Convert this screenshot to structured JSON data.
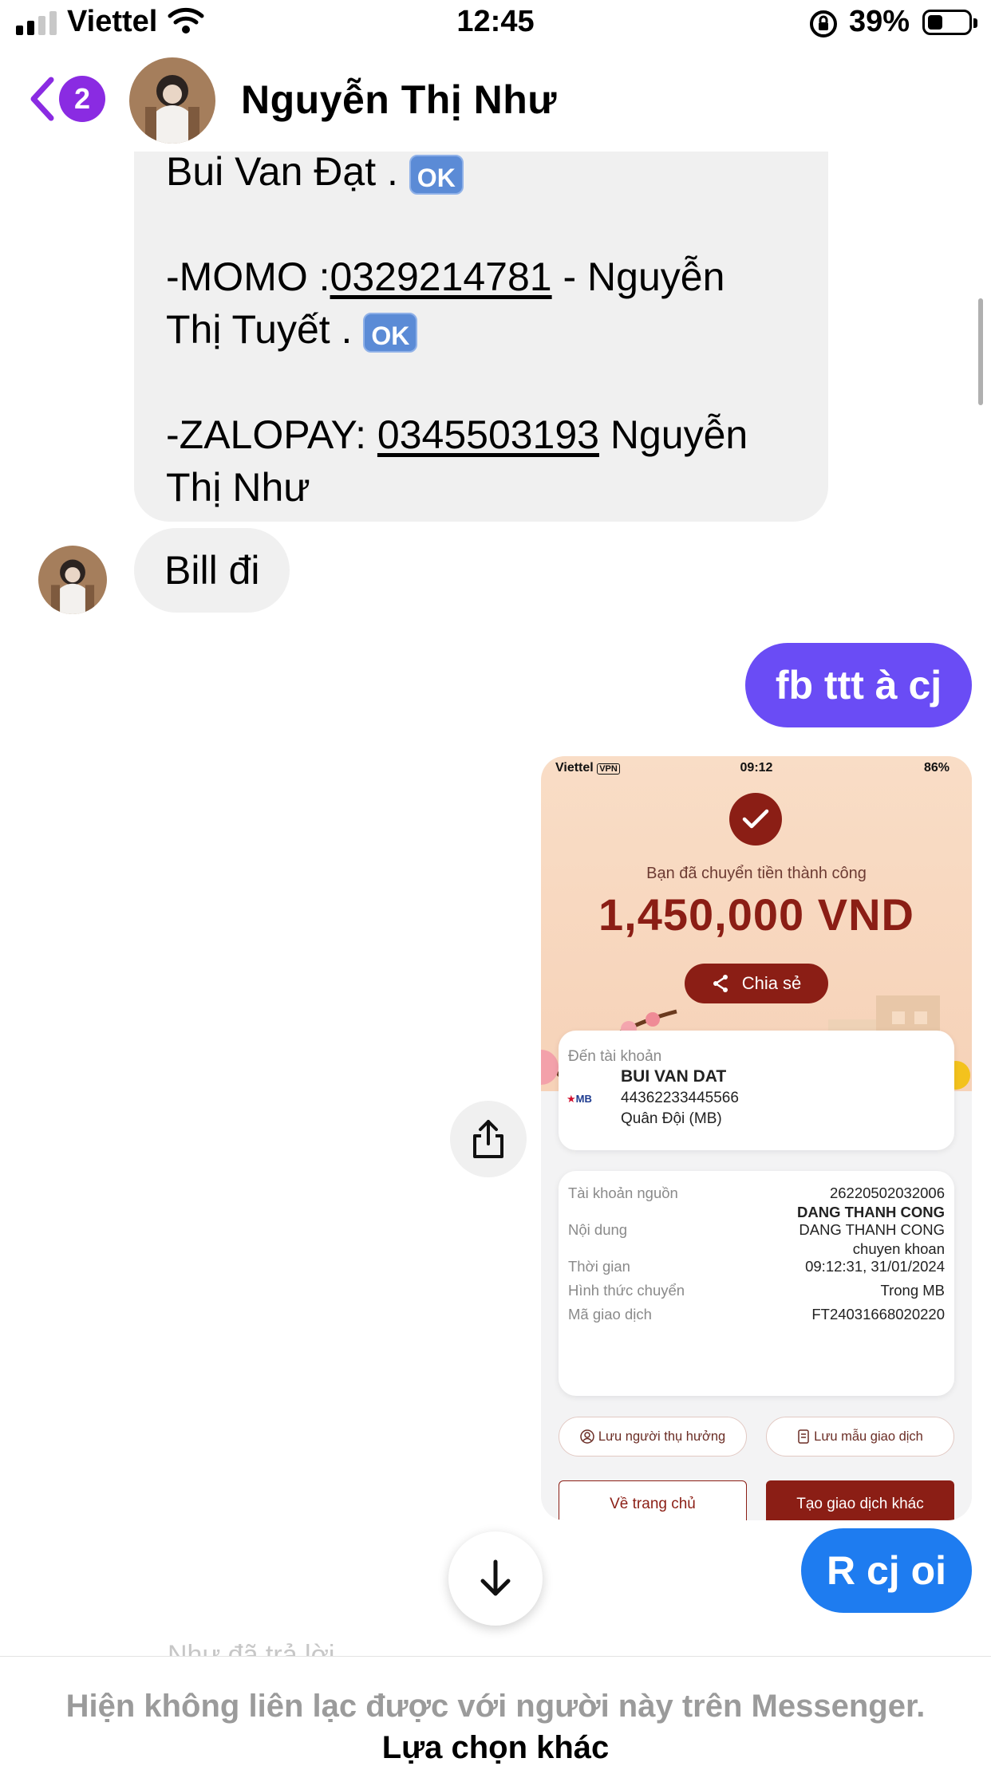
{
  "status_bar": {
    "carrier": "Viettel",
    "time": "12:45",
    "battery_percent": "39%"
  },
  "header": {
    "back_badge_count": "2",
    "contact_name": "Nguyễn Thị Như"
  },
  "messages": {
    "incoming_long": {
      "line1_text": "Bui Van Đạt . ",
      "line1_emoji": "OK",
      "momo_prefix": "-MOMO :",
      "momo_number": "0329214781",
      "momo_suffix": " - Nguyễn",
      "momo_name_line": "Thị Tuyết . ",
      "momo_emoji": "OK",
      "zalopay_prefix": "-ZALOPAY: ",
      "zalopay_number": "0345503193",
      "zalopay_suffix": " Nguyễn",
      "zalopay_name_line": "Thị Như"
    },
    "incoming_bill": "Bill đi",
    "outgoing_fb": "fb ttt à cj",
    "outgoing_rcj": "R cj oi"
  },
  "receipt": {
    "status_carrier": "Viettel",
    "status_vpn": "VPN",
    "status_time": "09:12",
    "status_battery": "86%",
    "success_text": "Bạn đã chuyển tiền thành công",
    "amount": "1,450,000 VND",
    "share_label": "Chia sẻ",
    "to_account_label": "Đến tài khoản",
    "bank_logo_text": "MB",
    "recipient_name": "BUI VAN DAT",
    "recipient_account": "44362233445566",
    "recipient_bank": "Quân Đội (MB)",
    "details": [
      {
        "label": "Tài khoản nguồn",
        "value": "26220502032006",
        "value2": "DANG THANH CONG"
      },
      {
        "label": "Nội dung",
        "value": "DANG THANH CONG",
        "value2": "chuyen khoan"
      },
      {
        "label": "Thời gian",
        "value": "09:12:31, 31/01/2024"
      },
      {
        "label": "Hình thức chuyển",
        "value": "Trong MB"
      },
      {
        "label": "Mã giao dịch",
        "value": "FT24031668020220"
      }
    ],
    "save_recipient": "Lưu người thụ hưởng",
    "save_template": "Lưu mẫu giao dịch",
    "home_button": "Về trang chủ",
    "new_transaction_button": "Tạo giao dịch khác"
  },
  "footer": {
    "faded_seen_text": "Như đã trả lời",
    "unavailable_notice": "Hiện không liên lạc được với người này trên Messenger.",
    "other_options": "Lựa chọn khác"
  },
  "colors": {
    "accent_purple": "#8a2be2",
    "outgoing_purple": "#6a4cf5",
    "outgoing_blue": "#1e7cf0",
    "receipt_red": "#8b1e15"
  }
}
